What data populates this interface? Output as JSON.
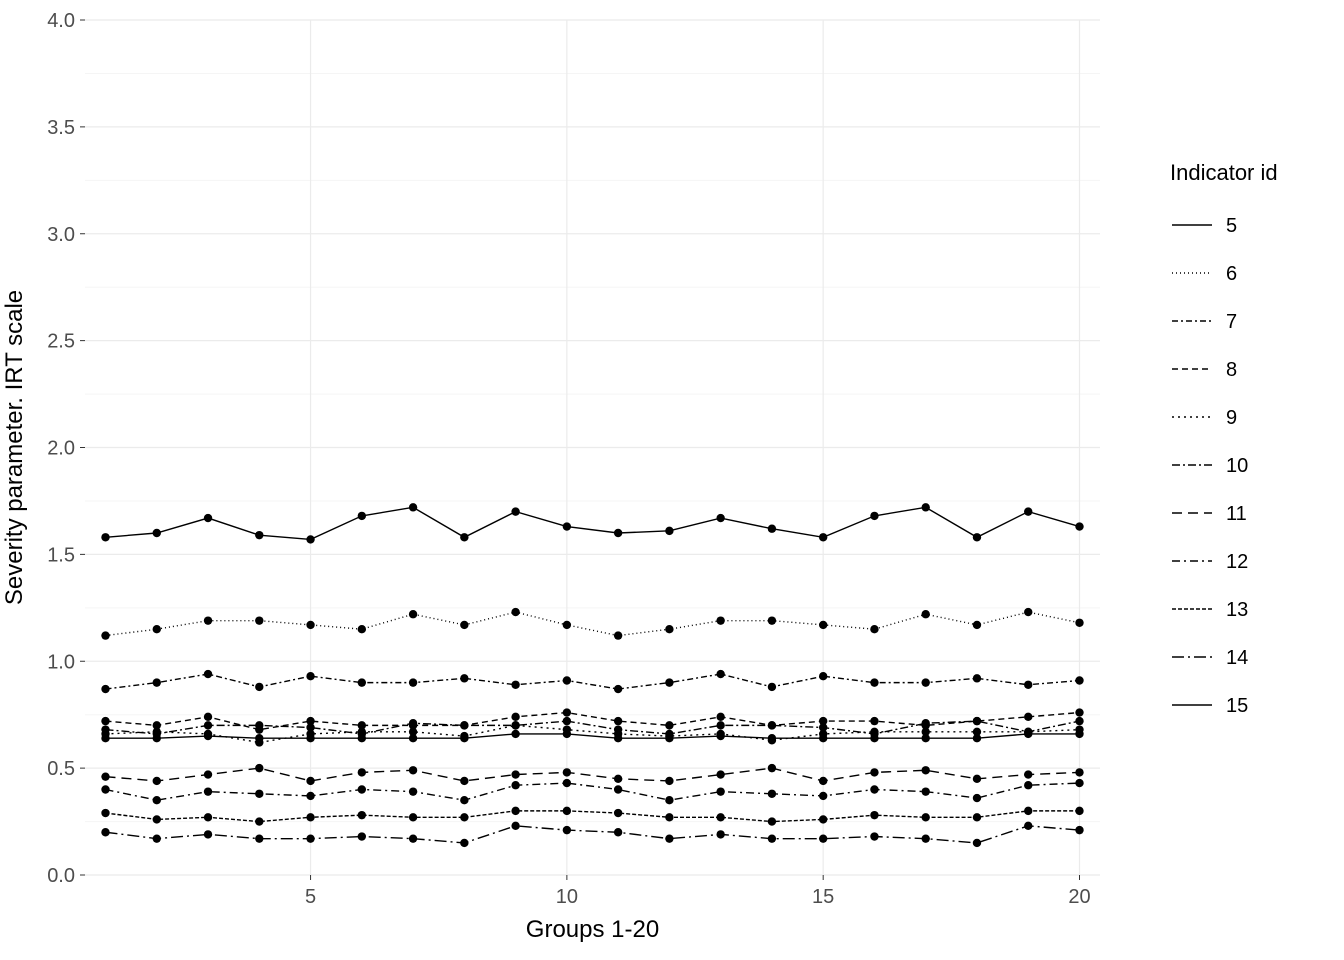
{
  "chart_data": {
    "type": "line",
    "title": "",
    "xlabel": "Groups 1-20",
    "ylabel": "Severity parameter. IRT scale",
    "legend_title": "Indicator id",
    "xlim": [
      0.6,
      20.4
    ],
    "ylim": [
      0.0,
      4.0
    ],
    "x_ticks_major": [
      5,
      10,
      15,
      20
    ],
    "y_ticks_major": [
      0.0,
      0.5,
      1.0,
      1.5,
      2.0,
      2.5,
      3.0,
      3.5,
      4.0
    ],
    "x": [
      1,
      2,
      3,
      4,
      5,
      6,
      7,
      8,
      9,
      10,
      11,
      12,
      13,
      14,
      15,
      16,
      17,
      18,
      19,
      20
    ],
    "series": [
      {
        "name": "5",
        "dash": "solid",
        "values": [
          1.58,
          1.6,
          1.67,
          1.59,
          1.57,
          1.68,
          1.72,
          1.58,
          1.7,
          1.63,
          1.6,
          1.61,
          1.67,
          1.62,
          1.58,
          1.68,
          1.72,
          1.58,
          1.7,
          1.63
        ]
      },
      {
        "name": "6",
        "dash": "1 3",
        "values": [
          1.12,
          1.15,
          1.19,
          1.19,
          1.17,
          1.15,
          1.22,
          1.17,
          1.23,
          1.17,
          1.12,
          1.15,
          1.19,
          1.19,
          1.17,
          1.15,
          1.22,
          1.17,
          1.23,
          1.18
        ]
      },
      {
        "name": "7",
        "dash": "6 3 2 3",
        "values": [
          0.87,
          0.9,
          0.94,
          0.88,
          0.93,
          0.9,
          0.9,
          0.92,
          0.89,
          0.91,
          0.87,
          0.9,
          0.94,
          0.88,
          0.93,
          0.9,
          0.9,
          0.92,
          0.89,
          0.91
        ]
      },
      {
        "name": "8",
        "dash": "6 4",
        "values": [
          0.72,
          0.7,
          0.74,
          0.68,
          0.72,
          0.7,
          0.7,
          0.7,
          0.74,
          0.76,
          0.72,
          0.7,
          0.74,
          0.7,
          0.72,
          0.72,
          0.7,
          0.72,
          0.74,
          0.76
        ]
      },
      {
        "name": "9",
        "dash": "2 4",
        "values": [
          0.66,
          0.67,
          0.66,
          0.62,
          0.66,
          0.67,
          0.67,
          0.65,
          0.7,
          0.68,
          0.66,
          0.65,
          0.66,
          0.63,
          0.66,
          0.67,
          0.67,
          0.67,
          0.67,
          0.68
        ]
      },
      {
        "name": "10",
        "dash": "8 3 2 3",
        "values": [
          0.68,
          0.66,
          0.7,
          0.7,
          0.69,
          0.66,
          0.71,
          0.7,
          0.7,
          0.72,
          0.68,
          0.66,
          0.7,
          0.7,
          0.69,
          0.66,
          0.71,
          0.72,
          0.67,
          0.72
        ]
      },
      {
        "name": "11",
        "dash": "10 6",
        "values": [
          0.46,
          0.44,
          0.47,
          0.5,
          0.44,
          0.48,
          0.49,
          0.44,
          0.47,
          0.48,
          0.45,
          0.44,
          0.47,
          0.5,
          0.44,
          0.48,
          0.49,
          0.45,
          0.47,
          0.48
        ]
      },
      {
        "name": "12",
        "dash": "8 4 2 4",
        "values": [
          0.4,
          0.35,
          0.39,
          0.38,
          0.37,
          0.4,
          0.39,
          0.35,
          0.42,
          0.43,
          0.4,
          0.35,
          0.39,
          0.38,
          0.37,
          0.4,
          0.39,
          0.36,
          0.42,
          0.43
        ]
      },
      {
        "name": "13",
        "dash": "4 2 4 2",
        "values": [
          0.29,
          0.26,
          0.27,
          0.25,
          0.27,
          0.28,
          0.27,
          0.27,
          0.3,
          0.3,
          0.29,
          0.27,
          0.27,
          0.25,
          0.26,
          0.28,
          0.27,
          0.27,
          0.3,
          0.3
        ]
      },
      {
        "name": "14",
        "dash": "12 4 2 4",
        "values": [
          0.2,
          0.17,
          0.19,
          0.17,
          0.17,
          0.18,
          0.17,
          0.15,
          0.23,
          0.21,
          0.2,
          0.17,
          0.19,
          0.17,
          0.17,
          0.18,
          0.17,
          0.15,
          0.23,
          0.21
        ]
      },
      {
        "name": "15",
        "dash": "solid",
        "values": [
          0.64,
          0.64,
          0.65,
          0.64,
          0.64,
          0.64,
          0.64,
          0.64,
          0.66,
          0.66,
          0.64,
          0.64,
          0.65,
          0.64,
          0.64,
          0.64,
          0.64,
          0.64,
          0.66,
          0.66
        ]
      }
    ],
    "colors": {
      "background": "#ffffff",
      "panel": "#ffffff",
      "grid_major": "#ebebeb",
      "grid_minor": "#f5f5f5",
      "line": "#000000",
      "point": "#000000",
      "tick_text": "#4d4d4d"
    }
  }
}
